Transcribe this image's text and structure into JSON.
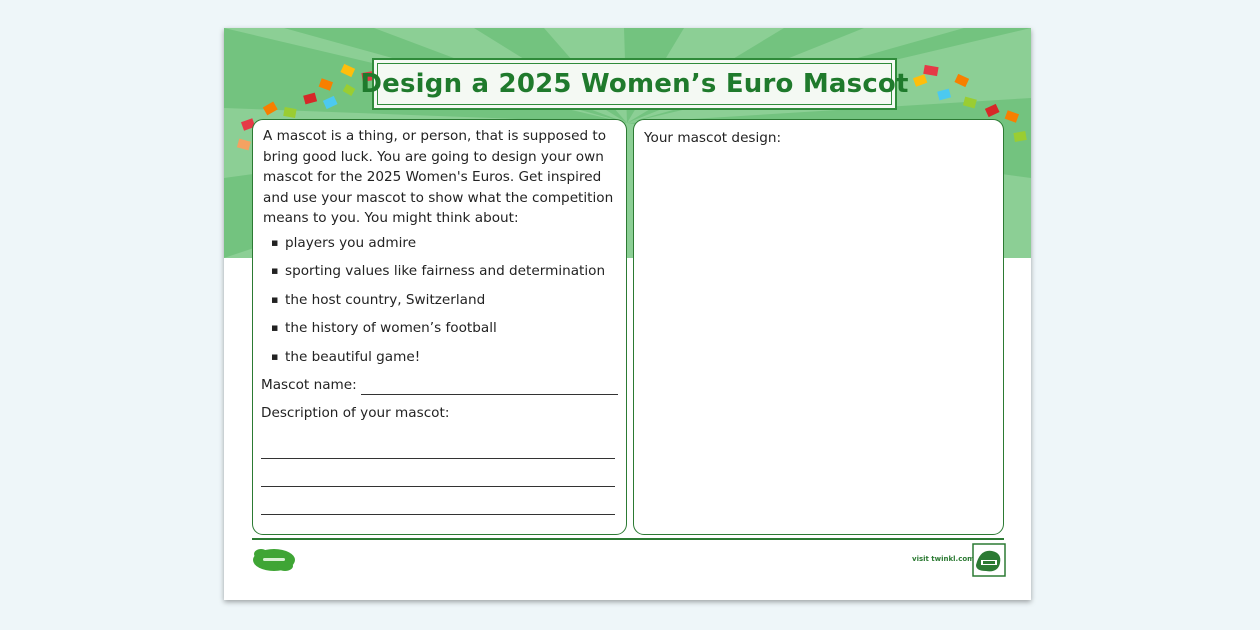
{
  "title": "Design a 2025 Women’s Euro Mascot",
  "intro": "A mascot is a thing, or person, that is supposed to bring good luck. You are going to design your own mascot for the 2025 Women's Euros. Get inspired and use your mascot to show what the competition means to you. You might think about:",
  "bullets": [
    "players you admire",
    "sporting values like fairness and determination",
    "the host country, Switzerland",
    "the history of women’s football",
    "the beautiful game!"
  ],
  "mascot_name_label": "Mascot name:",
  "description_label": "Description of your mascot:",
  "design_label": "Your mascot design:",
  "footer": {
    "visit_text": "visit twinkl.com"
  },
  "colors": {
    "brand_green": "#2c7a33",
    "title_green": "#1f7a2c",
    "banner_light": "#8ccf95",
    "banner_dark": "#6fbf7a"
  }
}
